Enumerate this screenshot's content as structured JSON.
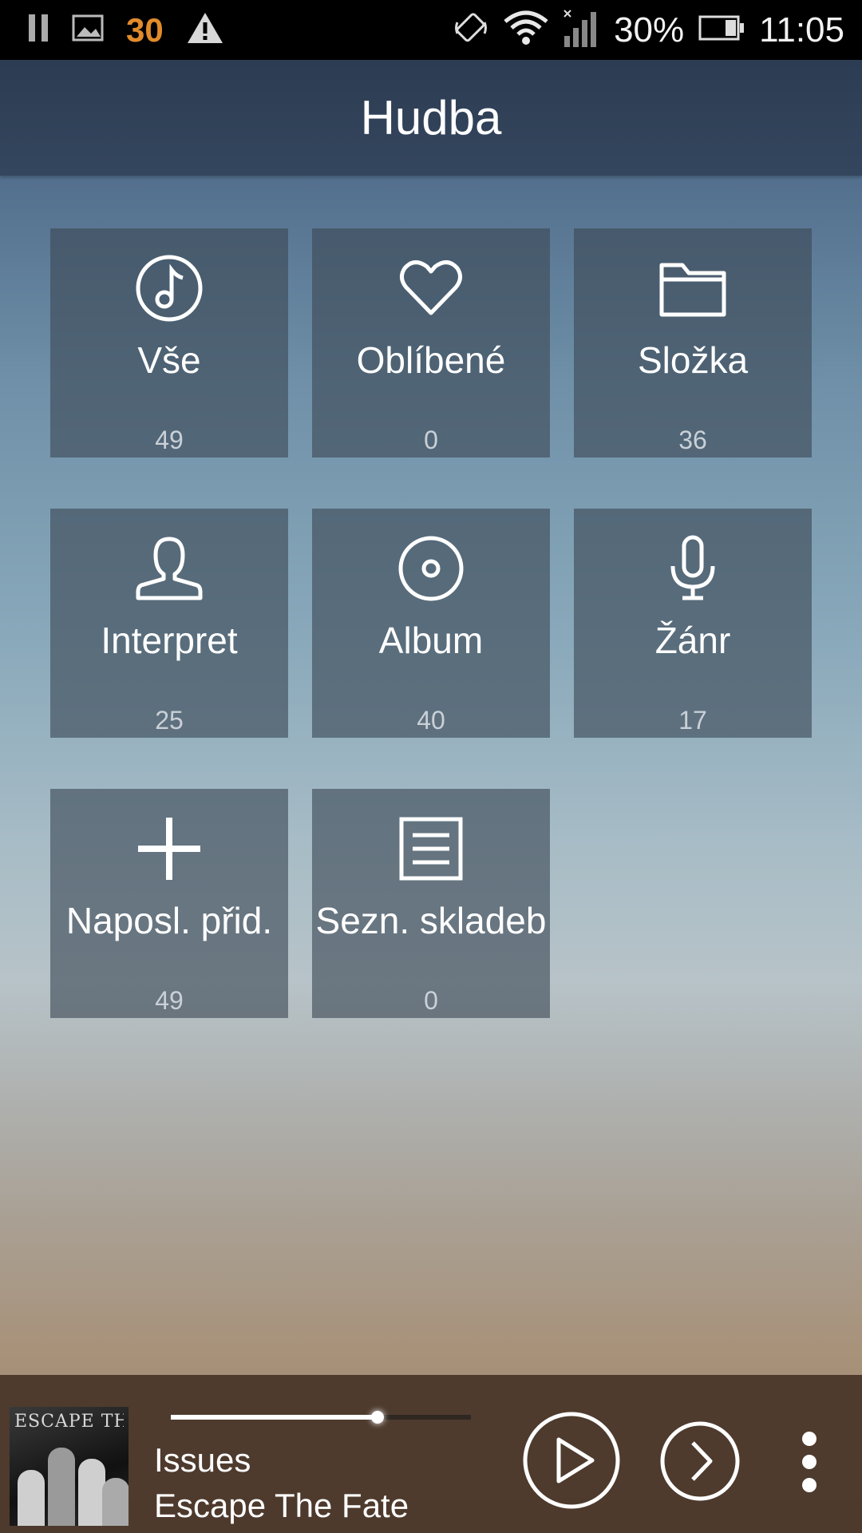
{
  "status_bar": {
    "notification_count": "30",
    "battery": "30%",
    "time": "11:05"
  },
  "header": {
    "title": "Hudba"
  },
  "tiles": [
    {
      "label": "Vše",
      "count": "49",
      "icon": "music-note-icon"
    },
    {
      "label": "Oblíbené",
      "count": "0",
      "icon": "heart-icon"
    },
    {
      "label": "Složka",
      "count": "36",
      "icon": "folder-icon"
    },
    {
      "label": "Interpret",
      "count": "25",
      "icon": "person-icon"
    },
    {
      "label": "Album",
      "count": "40",
      "icon": "disc-icon"
    },
    {
      "label": "Žánr",
      "count": "17",
      "icon": "microphone-icon"
    },
    {
      "label": "Naposl. přid.",
      "count": "49",
      "icon": "plus-icon"
    },
    {
      "label": "Sezn. skladeb",
      "count": "0",
      "icon": "list-icon"
    }
  ],
  "player": {
    "track_title": "Issues",
    "artist": "Escape The Fate",
    "progress": 0.69,
    "cover_text": "ESCAPE THE FATE"
  },
  "colors": {
    "accent_orange": "#e28b2b",
    "header_bg": "#2c3c52",
    "player_bg": "#463428"
  }
}
